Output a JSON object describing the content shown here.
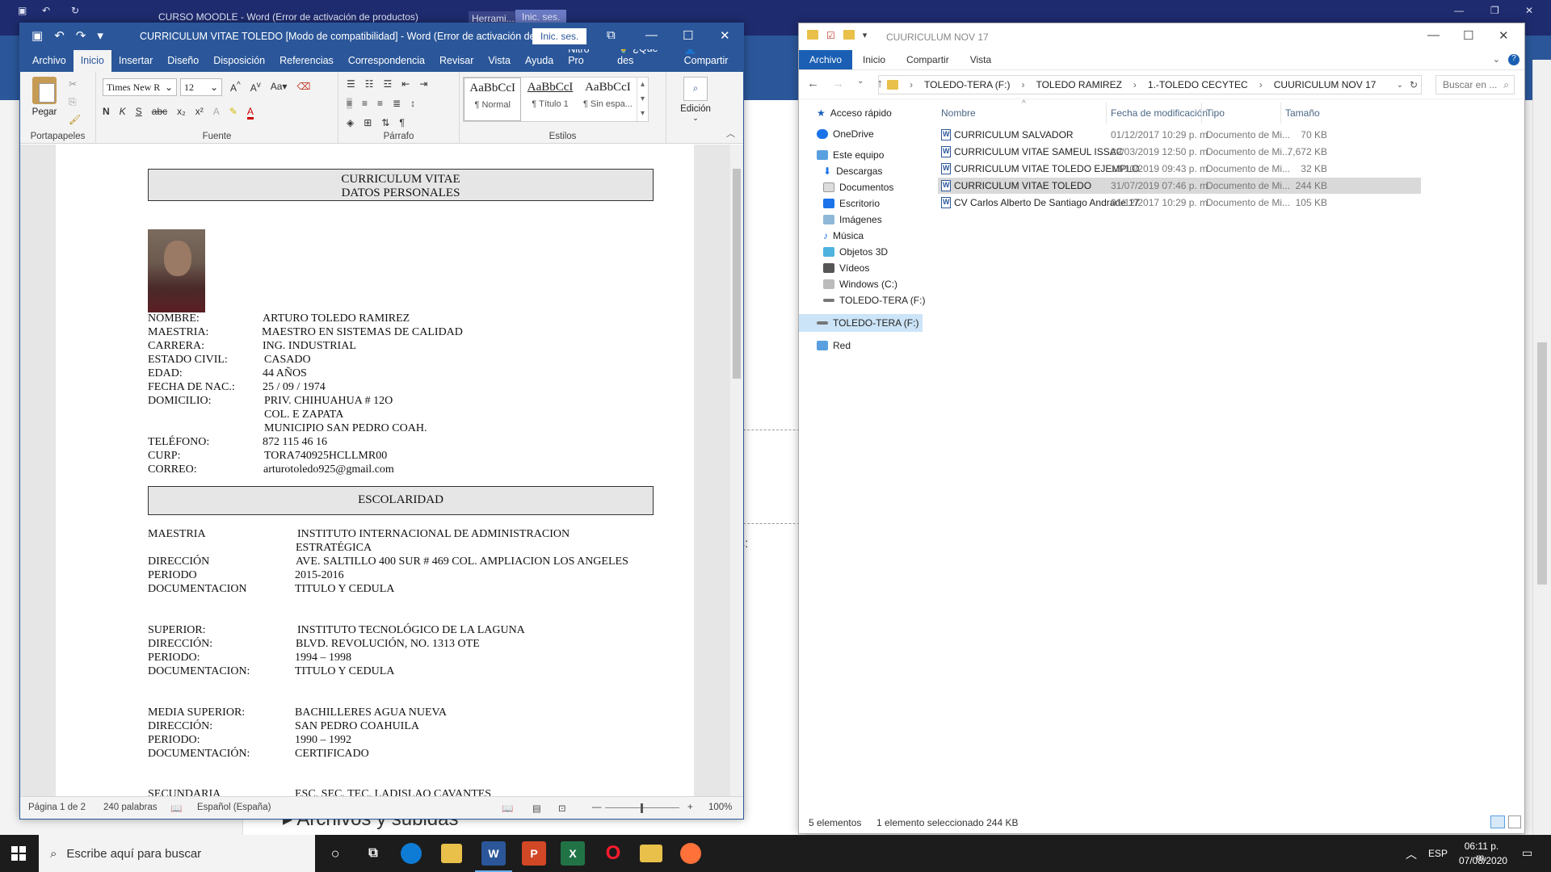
{
  "background_word": {
    "title": "CURSO MOODLE  -  Word (Error de activación de productos)",
    "herramientas": "Herrami...",
    "signin": "Inic. ses.",
    "side_text": "os:",
    "archivos_text": "Archivos y subidas"
  },
  "word": {
    "title": "CURRICULUM VITAE TOLEDO [Modo de compatibilidad]  -  Word (Error de activación de...",
    "signin": "Inic. ses.",
    "tabs": [
      "Archivo",
      "Inicio",
      "Insertar",
      "Diseño",
      "Disposición",
      "Referencias",
      "Correspondencia",
      "Revisar",
      "Vista",
      "Ayuda",
      "Nitro Pro",
      "¿Qué des",
      "Compartir"
    ],
    "active_tab": "Inicio",
    "ribbon": {
      "paste_label": "Pegar",
      "font_name": "Times New R",
      "font_size": "12",
      "groups": [
        "Portapapeles",
        "Fuente",
        "Párrafo",
        "Estilos",
        "Edición"
      ],
      "styles": [
        {
          "sample": "AaBbCcI",
          "name": "¶ Normal"
        },
        {
          "sample": "AaBbCcI",
          "name": "¶ Título 1"
        },
        {
          "sample": "AaBbCcI",
          "name": "¶ Sin espa..."
        }
      ],
      "edicion_label": "Edición"
    },
    "document": {
      "header1_line1": "CURRICULUM VITAE",
      "header1_line2": "DATOS PERSONALES",
      "personal": [
        {
          "label": "NOMBRE:",
          "value": "ARTURO TOLEDO RAMIREZ"
        },
        {
          "label": "MAESTRIA:",
          "value": "MAESTRO EN SISTEMAS DE CALIDAD"
        },
        {
          "label": "CARRERA:",
          "value": "ING. INDUSTRIAL"
        },
        {
          "label": "ESTADO CIVIL:",
          "value": "CASADO"
        },
        {
          "label": "EDAD:",
          "value": "44 AÑOS"
        },
        {
          "label": "FECHA DE NAC.:",
          "value": "25 / 09 / 1974"
        },
        {
          "label": "DOMICILIO:",
          "value": "PRIV. CHIHUAHUA # 12O"
        },
        {
          "label": "",
          "value": "COL. E ZAPATA"
        },
        {
          "label": "",
          "value": "MUNICIPIO SAN PEDRO COAH."
        },
        {
          "label": "TELÉFONO:",
          "value": "872 115 46 16"
        },
        {
          "label": "CURP:",
          "value": "TORA740925HCLLMR00"
        },
        {
          "label": "CORREO:",
          "value": "arturotoledo925@gmail.com"
        }
      ],
      "header2": "ESCOLARIDAD",
      "education": [
        {
          "label": "MAESTRIA",
          "value": "INSTITUTO INTERNACIONAL DE ADMINISTRACION"
        },
        {
          "label": "",
          "value": "ESTRATÉGICA"
        },
        {
          "label": "DIRECCIÓN",
          "value": "AVE. SALTILLO 400 SUR # 469 COL. AMPLIACION LOS ANGELES"
        },
        {
          "label": "PERIODO",
          "value": "2015-2016"
        },
        {
          "label": "DOCUMENTACION",
          "value": "TITULO Y CEDULA"
        },
        {
          "label": "SUPERIOR:",
          "value": "INSTITUTO TECNOLÓGICO DE LA LAGUNA"
        },
        {
          "label": "DIRECCIÓN:",
          "value": "BLVD. REVOLUCIÓN, NO. 1313 OTE"
        },
        {
          "label": "PERIODO:",
          "value": "1994 – 1998"
        },
        {
          "label": "DOCUMENTACION:",
          "value": "TITULO Y CEDULA"
        },
        {
          "label": "MEDIA SUPERIOR:",
          "value": "BACHILLERES AGUA NUEVA"
        },
        {
          "label": "DIRECCIÓN:",
          "value": "SAN PEDRO COAHUILA"
        },
        {
          "label": "PERIODO:",
          "value": "1990 – 1992"
        },
        {
          "label": "DOCUMENTACIÓN:",
          "value": "CERTIFICADO"
        },
        {
          "label": "SECUNDARIA",
          "value": "ESC. SEC. TEC. LADISLAO CAVANTES"
        }
      ]
    },
    "status": {
      "page": "Página 1 de 2",
      "words": "240 palabras",
      "language": "Español (España)",
      "zoom": "100%"
    }
  },
  "explorer": {
    "title": "CUURICULUM NOV 17",
    "tabs": [
      "Archivo",
      "Inicio",
      "Compartir",
      "Vista"
    ],
    "path": [
      "TOLEDO-TERA (F:)",
      "TOLEDO RAMIREZ",
      "1.-TOLEDO CECYTEC",
      "CUURICULUM NOV 17"
    ],
    "search_placeholder": "Buscar en ...",
    "columns": [
      "Nombre",
      "Fecha de modificación",
      "Tipo",
      "Tamaño"
    ],
    "nav": [
      "Acceso rápido",
      "OneDrive",
      "Este equipo",
      "Descargas",
      "Documentos",
      "Escritorio",
      "Imágenes",
      "Música",
      "Objetos 3D",
      "Vídeos",
      "Windows (C:)",
      "TOLEDO-TERA (F:)",
      "TOLEDO-TERA (F:)",
      "Red"
    ],
    "files": [
      {
        "name": "CURRICULUM SALVADOR",
        "date": "01/12/2017 10:29 p. m.",
        "type": "Documento de Mi...",
        "size": "70 KB"
      },
      {
        "name": "CURRICULUM VITAE SAMEUL ISSAC",
        "date": "29/03/2019 12:50 p. m.",
        "type": "Documento de Mi...",
        "size": "7,672 KB"
      },
      {
        "name": "CURRICULUM VITAE TOLEDO EJEMPLO",
        "date": "13/10/2019 09:43 p. m.",
        "type": "Documento de Mi...",
        "size": "32 KB"
      },
      {
        "name": "CURRICULUM VITAE TOLEDO",
        "date": "31/07/2019 07:46 p. m.",
        "type": "Documento de Mi...",
        "size": "244 KB"
      },
      {
        "name": "CV Carlos Alberto De Santiago Andrade 17",
        "date": "01/12/2017 10:29 p. m.",
        "type": "Documento de Mi...",
        "size": "105 KB"
      }
    ],
    "status_count": "5 elementos",
    "status_selected": "1 elemento seleccionado  244 KB"
  },
  "taskbar": {
    "search_placeholder": "Escribe aquí para buscar",
    "lang": "ESP",
    "time": "06:11 p. m.",
    "date": "07/08/2020"
  }
}
